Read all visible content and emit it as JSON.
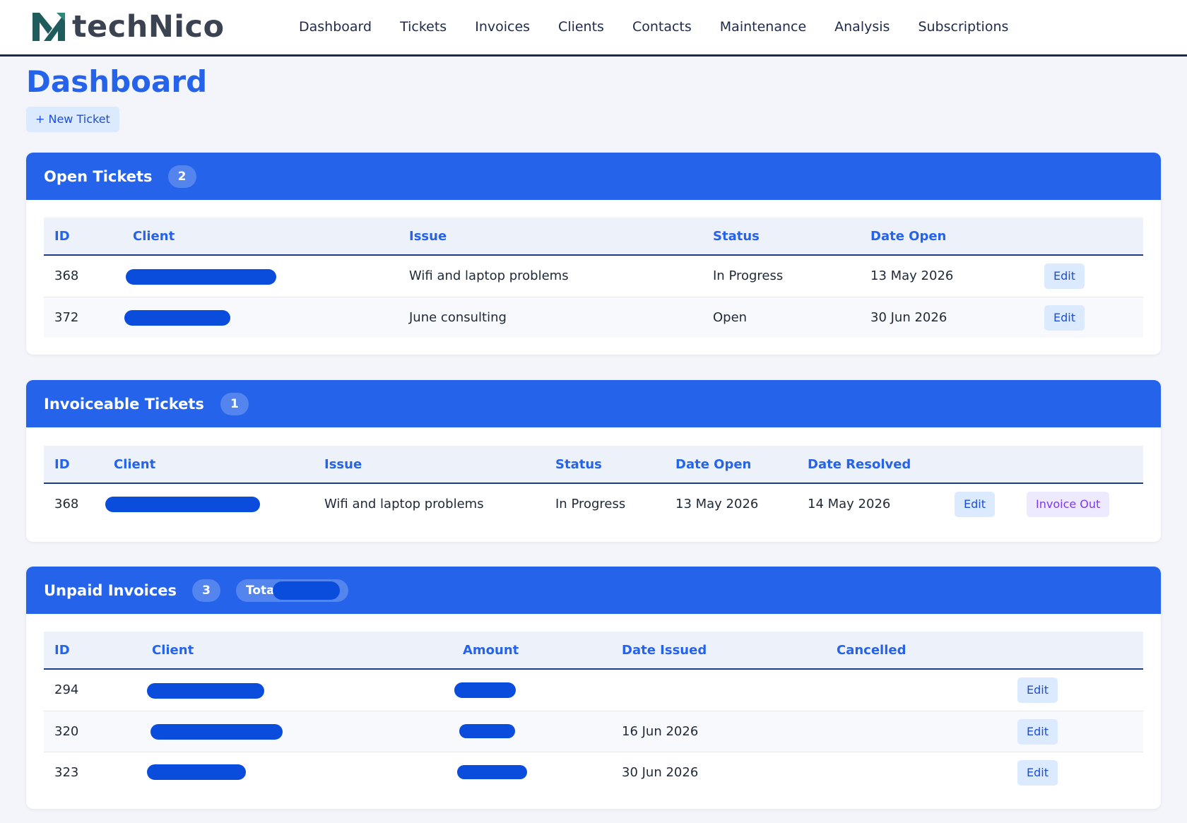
{
  "brand": {
    "name": "techNico"
  },
  "nav": [
    "Dashboard",
    "Tickets",
    "Invoices",
    "Clients",
    "Contacts",
    "Maintenance",
    "Analysis",
    "Subscriptions"
  ],
  "page": {
    "title": "Dashboard",
    "new_ticket_label": "+ New Ticket"
  },
  "open_tickets": {
    "title": "Open Tickets",
    "count": "2",
    "columns": [
      "ID",
      "Client",
      "Issue",
      "Status",
      "Date Open"
    ],
    "rows": [
      {
        "id": "368",
        "issue": "Wifi and laptop problems",
        "status": "In Progress",
        "date_open": "13 May 2026",
        "edit": "Edit"
      },
      {
        "id": "372",
        "issue": "June consulting",
        "status": "Open",
        "date_open": "30 Jun 2026",
        "edit": "Edit"
      }
    ]
  },
  "invoiceable_tickets": {
    "title": "Invoiceable Tickets",
    "count": "1",
    "columns": [
      "ID",
      "Client",
      "Issue",
      "Status",
      "Date Open",
      "Date Resolved"
    ],
    "rows": [
      {
        "id": "368",
        "issue": "Wifi and laptop problems",
        "status": "In Progress",
        "date_open": "13 May 2026",
        "date_resolved": "14 May 2026",
        "edit": "Edit",
        "invoice_out": "Invoice Out"
      }
    ]
  },
  "unpaid_invoices": {
    "title": "Unpaid Invoices",
    "count": "3",
    "total_label": "Total",
    "columns": [
      "ID",
      "Client",
      "Amount",
      "Date Issued",
      "Cancelled"
    ],
    "rows": [
      {
        "id": "294",
        "date_issued": "",
        "edit": "Edit"
      },
      {
        "id": "320",
        "date_issued": "16 Jun 2026",
        "edit": "Edit"
      },
      {
        "id": "323",
        "date_issued": "30 Jun 2026",
        "edit": "Edit"
      }
    ]
  },
  "colors": {
    "primary": "#2563eb",
    "nav_text": "#1e2a4a",
    "redaction": "#0a4ddc",
    "logo": "#1f5c5c"
  },
  "icons": {
    "logo": "technico-logo-icon"
  }
}
